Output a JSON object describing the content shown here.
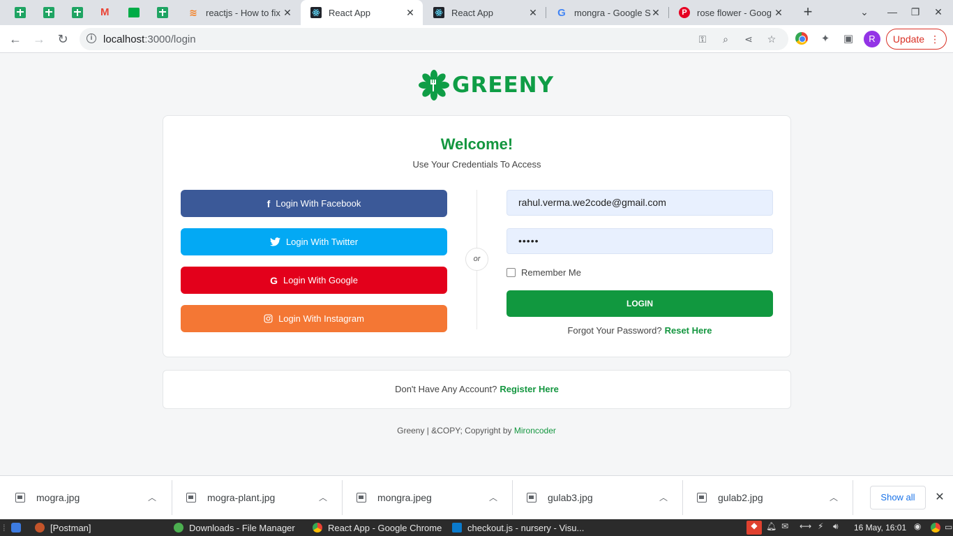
{
  "browser": {
    "tabs": [
      {
        "title": "reactjs - How to fix",
        "icon": "stackoverflow-icon"
      },
      {
        "title": "React App",
        "icon": "react-icon",
        "active": true
      },
      {
        "title": "React App",
        "icon": "react-icon"
      },
      {
        "title": "mongra - Google S",
        "icon": "google-icon"
      },
      {
        "title": "rose flower - Goog",
        "icon": "pinterest-icon"
      }
    ],
    "url_host": "localhost",
    "url_path": ":3000/login",
    "profile_initial": "R",
    "update_label": "Update"
  },
  "page": {
    "logo_text": "GREENY",
    "welcome": "Welcome!",
    "subtitle": "Use Your Credentials To Access",
    "social": {
      "facebook": "Login With Facebook",
      "twitter": "Login With Twitter",
      "google": "Login With Google",
      "instagram": "Login With Instagram"
    },
    "or_label": "or",
    "email_value": "rahul.verma.we2code@gmail.com",
    "password_mask": "•••••",
    "remember_label": "Remember Me",
    "login_label": "LOGIN",
    "forgot_text": "Forgot Your Password?",
    "reset_link": "Reset Here",
    "no_account_text": "Don't Have Any Account?",
    "register_link": "Register Here",
    "footer_text": "Greeny | &COPY; Copyright by",
    "footer_link": "Mironcoder",
    "brand_color": "#13963f"
  },
  "downloads": {
    "items": [
      "mogra.jpg",
      "mogra-plant.jpg",
      "mongra.jpeg",
      "gulab3.jpg",
      "gulab2.jpg"
    ],
    "show_all": "Show all"
  },
  "taskbar": {
    "tasks": [
      "[Postman]",
      "Downloads - File Manager",
      "React App - Google Chrome",
      "checkout.js - nursery - Visu..."
    ],
    "clock": "16 May, 16:01"
  }
}
